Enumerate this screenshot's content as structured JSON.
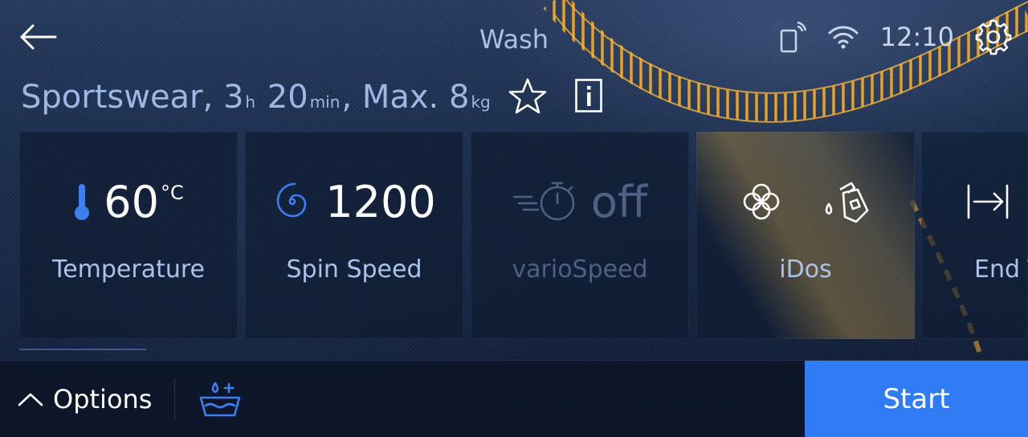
{
  "header": {
    "title": "Wash",
    "time": "12:10"
  },
  "program": {
    "name": "Sportswear,",
    "hours": "3",
    "hours_unit": "h",
    "minutes": "20",
    "minutes_unit": "min",
    "load_prefix": ", Max.",
    "load": "8",
    "load_unit": "kg"
  },
  "tiles": [
    {
      "value": "60",
      "unit": "°C",
      "label": "Temperature",
      "icon": "thermometer-icon",
      "enabled": true
    },
    {
      "value": "1200",
      "label": "Spin Speed",
      "icon": "spin-icon",
      "enabled": true
    },
    {
      "value": "off",
      "label": "varioSpeed",
      "icon": "stopwatch-icon",
      "enabled": false
    },
    {
      "label": "iDos",
      "icons": [
        "flower-icon",
        "detergent-bottle-icon"
      ],
      "enabled": true
    },
    {
      "label": "End T",
      "icon": "end-time-icon",
      "enabled": true
    }
  ],
  "bottom": {
    "options_label": "Options",
    "start_label": "Start"
  },
  "colors": {
    "accent": "#2f7bf4",
    "label": "#aac3ea",
    "disabled": "#4e6185",
    "stitch": "#f2a623"
  }
}
